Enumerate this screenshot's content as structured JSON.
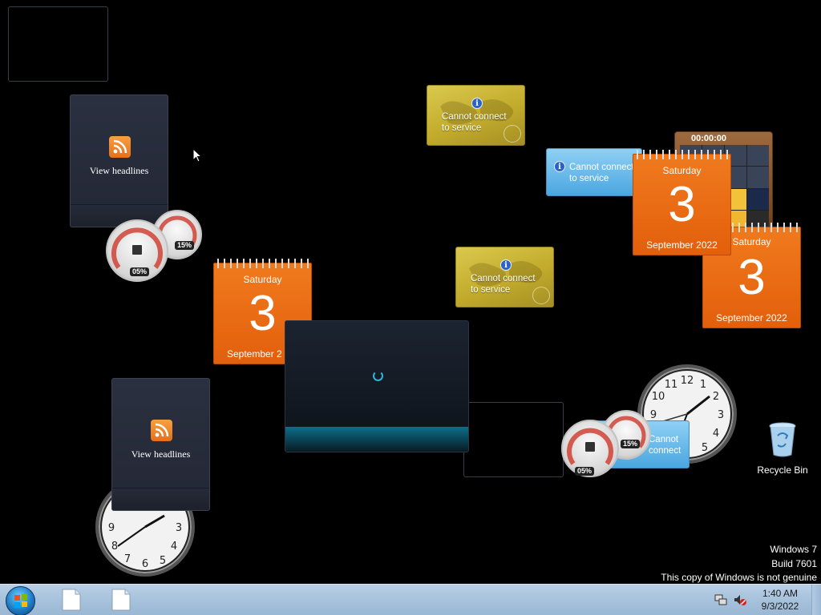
{
  "desktop": {
    "feed_label": "View headlines",
    "service_message": "Cannot connect to service",
    "service_message_line1": "Cannot connect",
    "service_message_line2": "to service",
    "calendar": {
      "weekday": "Saturday",
      "day": "3",
      "month_year": "September 2022"
    },
    "calendar_clipped_month_year": "September 2",
    "meter_cpu": "05%",
    "meter_mem": "15%",
    "puzzle_timer": "00:00:00",
    "recycle_bin_label": "Recycle Bin",
    "watermark": {
      "line1": "Windows 7",
      "line2": "Build 7601",
      "line3": "This copy of Windows is not genuine"
    }
  },
  "taskbar": {
    "time": "1:40 AM",
    "date": "9/3/2022",
    "items": [
      "document",
      "document"
    ]
  },
  "colors": {
    "desktop": "#000000",
    "calendar": "#e8680f",
    "gold_gadget": "#c9b33a",
    "blue_gadget": "#5ab2e8",
    "taskbar": "#a9c4de"
  },
  "icons": [
    "rss-icon",
    "info-icon",
    "globe-icon",
    "recycle-bin-icon",
    "windows-start-icon",
    "document-icon",
    "network-icon",
    "volume-muted-icon",
    "mouse-cursor-icon"
  ]
}
